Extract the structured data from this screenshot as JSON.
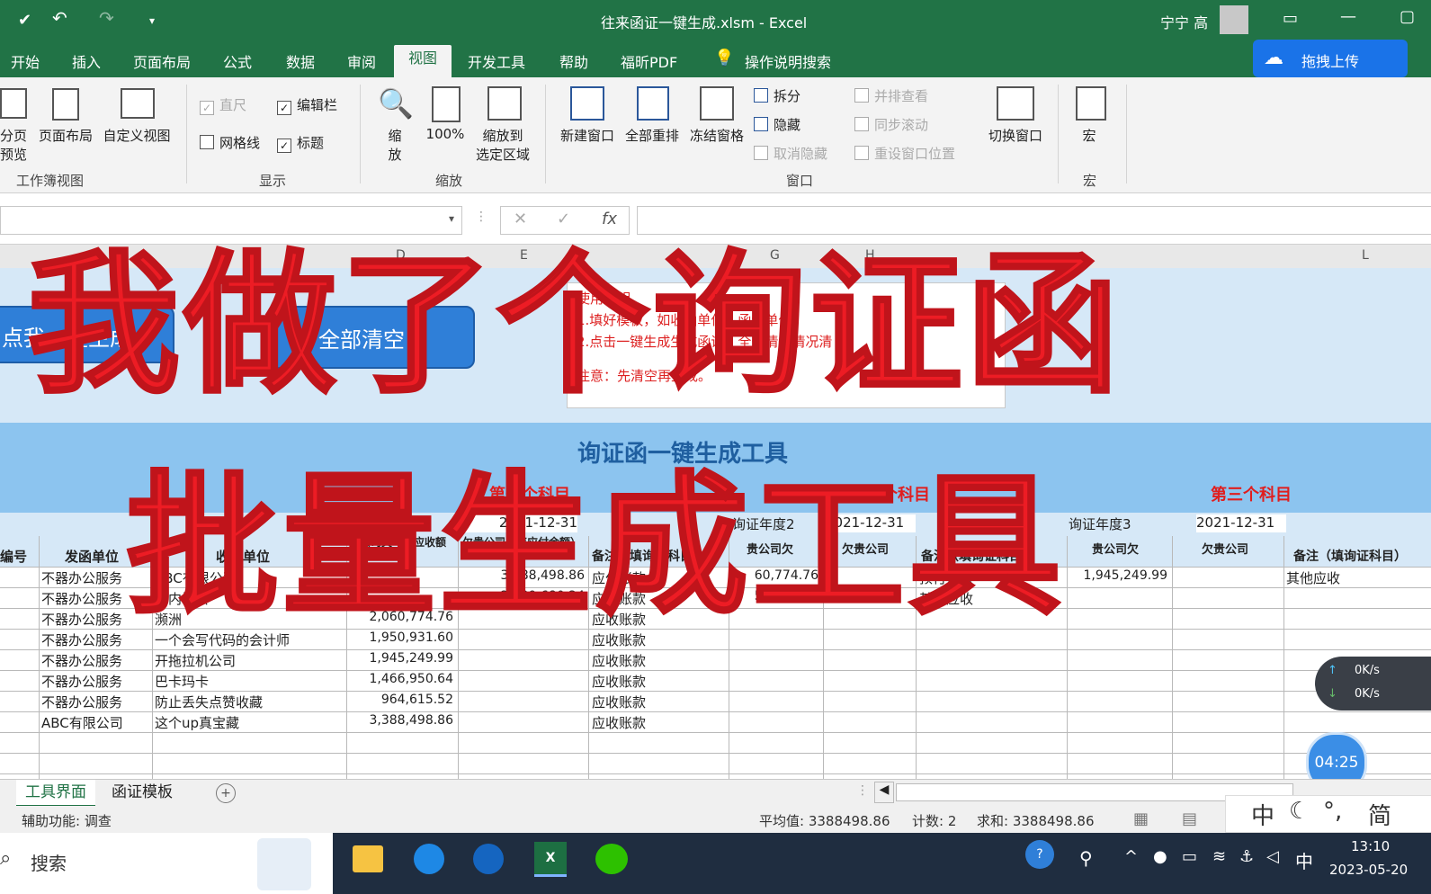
{
  "window": {
    "title": "往来函证一键生成.xlsm  -  Excel",
    "user": "宁宁 高"
  },
  "ribbon_tabs": [
    "开始",
    "插入",
    "页面布局",
    "公式",
    "数据",
    "审阅",
    "视图",
    "开发工具",
    "帮助",
    "福昕PDF",
    "操作说明搜索"
  ],
  "upload_label": "拖拽上传",
  "ribbon": {
    "workbook_views": {
      "page_break": "分页\n预览",
      "page_layout": "页面布局",
      "custom": "自定义视图",
      "group": "工作簿视图"
    },
    "show": {
      "ruler": "直尺",
      "formula_bar": "编辑栏",
      "gridlines": "网格线",
      "headings": "标题",
      "group": "显示"
    },
    "zoom": {
      "zoom": "缩\n放",
      "hundred": "100%",
      "fit": "缩放到\n选定区域",
      "group": "缩放"
    },
    "window": {
      "new": "新建窗口",
      "arrange": "全部重排",
      "freeze": "冻结窗格",
      "split": "拆分",
      "hide": "隐藏",
      "unhide": "取消隐藏",
      "side": "并排查看",
      "sync": "同步滚动",
      "reset": "重设窗口位置",
      "switch": "切换窗口",
      "group": "窗口"
    },
    "macro": {
      "label": "宏",
      "group": "宏"
    }
  },
  "formula_bar": {
    "fx": "fx"
  },
  "columns": [
    "D",
    "E",
    "G",
    "H",
    "L"
  ],
  "buttons": {
    "generate": "点我一键生成",
    "clear": "全部清空"
  },
  "instructions": {
    "title": "使用说明",
    "line1": "1.填好模板，如收函单位、函证单位。",
    "line2": "2.点击一键生成生成函证，全部情况情况清",
    "note": "注意：先清空再生成。"
  },
  "banner": {
    "title": "询证函一键生成工具",
    "subject1": "第一个科目",
    "subject2": "第二个科目",
    "subject3": "第三个科目",
    "year1_label": "询证年度1",
    "year1": "2021-12-31",
    "year2_label": "询证年度2",
    "year2": "2021-12-31",
    "year3_label": "询证年度3",
    "year3": "2021-12-31"
  },
  "headers": [
    "编号",
    "发函单位",
    "收函单位",
    "贵公司欠（填应收额度）",
    "欠贵公司（填应付余额）",
    "备注（填询证科目）",
    "贵公司欠",
    "欠贵公司",
    "备注（填询证科目）",
    "贵公司欠",
    "欠贵公司",
    "备注（填询证科目）"
  ],
  "rows": [
    [
      "不器办公服务",
      "ABC有限公司",
      "",
      "3,388,498.86",
      "应付账款",
      "60,774.76",
      "",
      "预付账款",
      "1,945,249.99",
      "",
      "其他应收"
    ],
    [
      "不器办公服务",
      "友内协会",
      "",
      "2,439,680.24",
      "应付账款",
      "50,000.00",
      "",
      "其他应收",
      "",
      "",
      ""
    ],
    [
      "不器办公服务",
      "濒洲",
      "2,060,774.76",
      "",
      "应收账款",
      "",
      "",
      "",
      "",
      "",
      ""
    ],
    [
      "不器办公服务",
      "一个会写代码的会计师",
      "1,950,931.60",
      "",
      "应收账款",
      "",
      "",
      "",
      "",
      "",
      ""
    ],
    [
      "不器办公服务",
      "开拖拉机公司",
      "1,945,249.99",
      "",
      "应收账款",
      "",
      "",
      "",
      "",
      "",
      ""
    ],
    [
      "不器办公服务",
      "巴卡玛卡",
      "1,466,950.64",
      "",
      "应收账款",
      "",
      "",
      "",
      "",
      "",
      ""
    ],
    [
      "不器办公服务",
      "防止丢失点赞收藏",
      "964,615.52",
      "",
      "应收账款",
      "",
      "",
      "",
      "",
      "",
      ""
    ],
    [
      "ABC有限公司",
      "这个up真宝藏",
      "3,388,498.86",
      "",
      "应收账款",
      "",
      "",
      "",
      "",
      "",
      ""
    ]
  ],
  "overlay": {
    "line1": "我做了个询证函",
    "line2": "批量生成工具"
  },
  "sheet_tabs": [
    "工具界面",
    "函证模板"
  ],
  "status": {
    "accessibility": "辅助功能: 调查",
    "average": "平均值: 3388498.86",
    "count": "计数: 2",
    "sum": "求和: 3388498.86"
  },
  "net_speed": {
    "up": "0K/s",
    "down": "0K/s"
  },
  "timer": "04:25",
  "ime": {
    "mode": "中",
    "script": "简"
  },
  "taskbar": {
    "search": "搜索",
    "lang": "中",
    "time": "13:10",
    "date": "2023-05-20"
  }
}
